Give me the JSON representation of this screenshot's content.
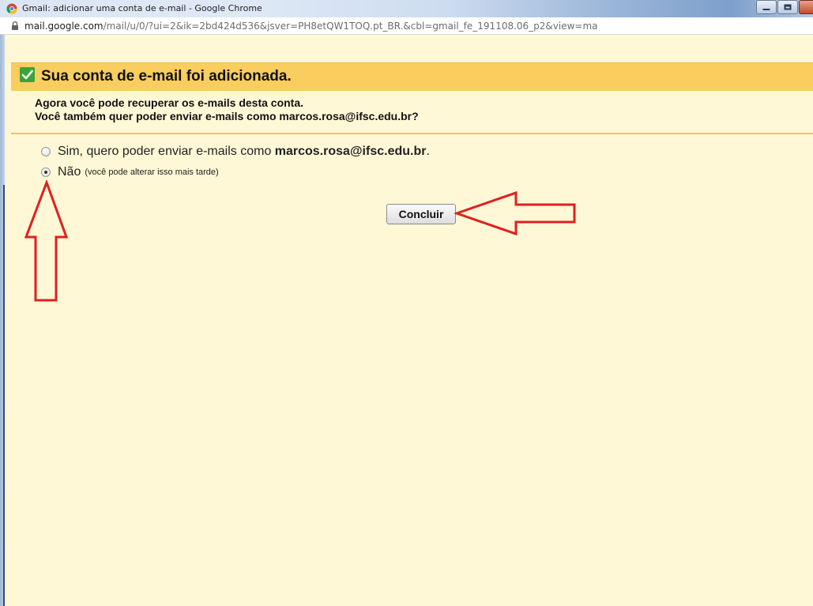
{
  "window": {
    "title": "Gmail: adicionar uma conta de e-mail - Google Chrome"
  },
  "address_bar": {
    "host": "mail.google.com",
    "path": "/mail/u/0/?ui=2&ik=2bd424d536&jsver=PH8etQW1TOQ.pt_BR.&cbl=gmail_fe_191108.06_p2&view=ma"
  },
  "banner": {
    "title": "Sua conta de e-mail foi adicionada."
  },
  "info": {
    "line1": "Agora você pode recuperar os e-mails desta conta.",
    "line2": "Você também quer poder enviar e-mails como marcos.rosa@ifsc.edu.br?"
  },
  "options": {
    "yes": {
      "text": "Sim, quero poder enviar e-mails como ",
      "email": "marcos.rosa@ifsc.edu.br",
      "suffix": ".",
      "selected": false
    },
    "no": {
      "text": "Não",
      "note": "(você pode alterar isso mais tarde)",
      "selected": true
    }
  },
  "actions": {
    "finish_label": "Concluir"
  },
  "colors": {
    "page_background": "#fff8d6",
    "banner_background": "#f9cd5e",
    "check_green": "#3aa43a",
    "annotation_red": "#e02020"
  },
  "icons": {
    "browser": "chrome-logo-icon",
    "lock": "lock-icon",
    "success": "checkmark-icon"
  }
}
